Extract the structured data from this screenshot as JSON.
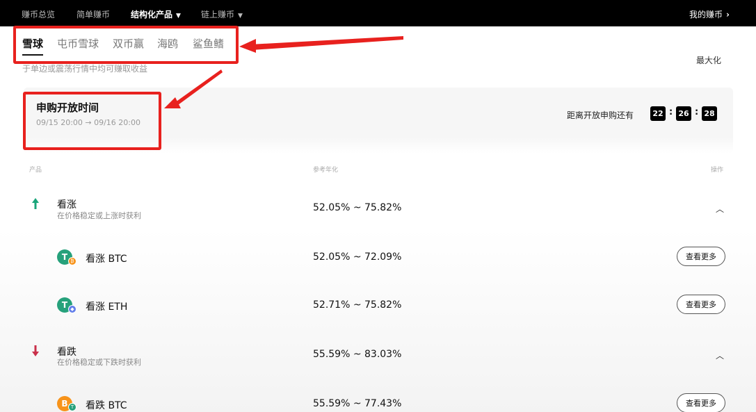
{
  "topnav": {
    "items": [
      "赚币总览",
      "简单赚币",
      "结构化产品",
      "链上赚币"
    ],
    "right_link": "我的赚币"
  },
  "tabs": [
    "雪球",
    "屯币雪球",
    "双币赢",
    "海鸥",
    "鲨鱼鳍"
  ],
  "subtitle": "于单边或震荡行情中均可赚取收益",
  "top_right_link": "最大化",
  "panel": {
    "title": "申购开放时间",
    "time": "09/15 20:00 → 09/16 20:00",
    "countdown_label": "距离开放申购还有",
    "countdown": {
      "h": "22",
      "m": "26",
      "s": "28"
    }
  },
  "table": {
    "headers": {
      "product": "产品",
      "apy": "参考年化",
      "action": "操作"
    }
  },
  "groups": [
    {
      "icon": "arrow-up-icon",
      "color": "#1aa57a",
      "name": "看涨",
      "desc": "在价格稳定或上涨时获利",
      "rate": "52.05% ~ 75.82%",
      "products": [
        {
          "name": "看涨 BTC",
          "rate": "52.05% ~ 72.09%",
          "coin": "T",
          "coin_color": "#26a17b",
          "sub_coin_color": "#f7931a",
          "action": "查看更多"
        },
        {
          "name": "看涨 ETH",
          "rate": "52.71% ~ 75.82%",
          "coin": "T",
          "coin_color": "#26a17b",
          "sub_coin_color": "#627eea",
          "action": "查看更多"
        }
      ]
    },
    {
      "icon": "arrow-down-icon",
      "color": "#c9304a",
      "name": "看跌",
      "desc": "在价格稳定或下跌时获利",
      "rate": "55.59% ~ 83.03%",
      "products": [
        {
          "name": "看跌 BTC",
          "rate": "55.59% ~ 77.43%",
          "coin": "B",
          "coin_color": "#f7931a",
          "sub_coin_color": "#26a17b",
          "action": "查看更多"
        }
      ]
    }
  ]
}
